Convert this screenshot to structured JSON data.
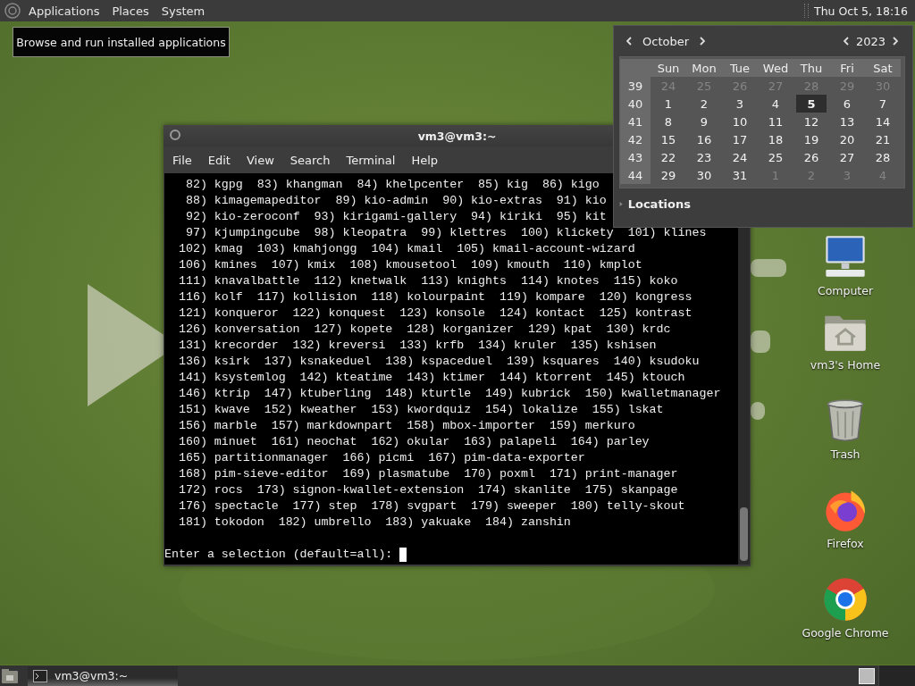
{
  "top_panel": {
    "menus": [
      {
        "label": "Applications"
      },
      {
        "label": "Places"
      },
      {
        "label": "System"
      }
    ],
    "clock": "Thu Oct 5, 18:16"
  },
  "tooltip": "Browse and run installed applications",
  "terminal": {
    "title": "vm3@vm3:~",
    "menu": [
      "File",
      "Edit",
      "View",
      "Search",
      "Terminal",
      "Help"
    ],
    "lines": [
      "82) kgpg  83) khangman  84) khelpcenter  85) kig  86) kigo",
      "88) kimagemapeditor  89) kio-admin  90) kio-extras  91) kio",
      "92) kio-zeroconf  93) kirigami-gallery  94) kiriki  95) kit",
      "97) kjumpingcube  98) kleopatra  99) klettres  100) klickety  101) klines",
      "102) kmag  103) kmahjongg  104) kmail  105) kmail-account-wizard",
      "106) kmines  107) kmix  108) kmousetool  109) kmouth  110) kmplot",
      "111) knavalbattle  112) knetwalk  113) knights  114) knotes  115) koko",
      "116) kolf  117) kollision  118) kolourpaint  119) kompare  120) kongress",
      "121) konqueror  122) konquest  123) konsole  124) kontact  125) kontrast",
      "126) konversation  127) kopete  128) korganizer  129) kpat  130) krdc",
      "131) krecorder  132) kreversi  133) krfb  134) kruler  135) kshisen",
      "136) ksirk  137) ksnakeduel  138) kspaceduel  139) ksquares  140) ksudoku",
      "141) ksystemlog  142) kteatime  143) ktimer  144) ktorrent  145) ktouch",
      "146) ktrip  147) ktuberling  148) kturtle  149) kubrick  150) kwalletmanager",
      "151) kwave  152) kweather  153) kwordquiz  154) lokalize  155) lskat",
      "156) marble  157) markdownpart  158) mbox-importer  159) merkuro",
      "160) minuet  161) neochat  162) okular  163) palapeli  164) parley",
      "165) partitionmanager  166) picmi  167) pim-data-exporter",
      "168) pim-sieve-editor  169) plasmatube  170) poxml  171) print-manager",
      "172) rocs  173) signon-kwallet-extension  174) skanlite  175) skanpage",
      "176) spectacle  177) step  178) svgpart  179) sweeper  180) telly-skout",
      "181) tokodon  182) umbrello  183) yakuake  184) zanshin"
    ],
    "prompt": "Enter a selection (default=all):"
  },
  "calendar": {
    "month": "October",
    "year": "2023",
    "weekdays": [
      "Sun",
      "Mon",
      "Tue",
      "Wed",
      "Thu",
      "Fri",
      "Sat"
    ],
    "weeks": [
      {
        "number": "39",
        "days": [
          {
            "day": "24",
            "other_month": true,
            "selected": false
          },
          {
            "day": "25",
            "other_month": true,
            "selected": false
          },
          {
            "day": "26",
            "other_month": true,
            "selected": false
          },
          {
            "day": "27",
            "other_month": true,
            "selected": false
          },
          {
            "day": "28",
            "other_month": true,
            "selected": false
          },
          {
            "day": "29",
            "other_month": true,
            "selected": false
          },
          {
            "day": "30",
            "other_month": true,
            "selected": false
          }
        ]
      },
      {
        "number": "40",
        "days": [
          {
            "day": "1",
            "other_month": false,
            "selected": false
          },
          {
            "day": "2",
            "other_month": false,
            "selected": false
          },
          {
            "day": "3",
            "other_month": false,
            "selected": false
          },
          {
            "day": "4",
            "other_month": false,
            "selected": false
          },
          {
            "day": "5",
            "other_month": false,
            "selected": true
          },
          {
            "day": "6",
            "other_month": false,
            "selected": false
          },
          {
            "day": "7",
            "other_month": false,
            "selected": false
          }
        ]
      },
      {
        "number": "41",
        "days": [
          {
            "day": "8",
            "other_month": false,
            "selected": false
          },
          {
            "day": "9",
            "other_month": false,
            "selected": false
          },
          {
            "day": "10",
            "other_month": false,
            "selected": false
          },
          {
            "day": "11",
            "other_month": false,
            "selected": false
          },
          {
            "day": "12",
            "other_month": false,
            "selected": false
          },
          {
            "day": "13",
            "other_month": false,
            "selected": false
          },
          {
            "day": "14",
            "other_month": false,
            "selected": false
          }
        ]
      },
      {
        "number": "42",
        "days": [
          {
            "day": "15",
            "other_month": false,
            "selected": false
          },
          {
            "day": "16",
            "other_month": false,
            "selected": false
          },
          {
            "day": "17",
            "other_month": false,
            "selected": false
          },
          {
            "day": "18",
            "other_month": false,
            "selected": false
          },
          {
            "day": "19",
            "other_month": false,
            "selected": false
          },
          {
            "day": "20",
            "other_month": false,
            "selected": false
          },
          {
            "day": "21",
            "other_month": false,
            "selected": false
          }
        ]
      },
      {
        "number": "43",
        "days": [
          {
            "day": "22",
            "other_month": false,
            "selected": false
          },
          {
            "day": "23",
            "other_month": false,
            "selected": false
          },
          {
            "day": "24",
            "other_month": false,
            "selected": false
          },
          {
            "day": "25",
            "other_month": false,
            "selected": false
          },
          {
            "day": "26",
            "other_month": false,
            "selected": false
          },
          {
            "day": "27",
            "other_month": false,
            "selected": false
          },
          {
            "day": "28",
            "other_month": false,
            "selected": false
          }
        ]
      },
      {
        "number": "44",
        "days": [
          {
            "day": "29",
            "other_month": false,
            "selected": false
          },
          {
            "day": "30",
            "other_month": false,
            "selected": false
          },
          {
            "day": "31",
            "other_month": false,
            "selected": false
          },
          {
            "day": "1",
            "other_month": true,
            "selected": false
          },
          {
            "day": "2",
            "other_month": true,
            "selected": false
          },
          {
            "day": "3",
            "other_month": true,
            "selected": false
          },
          {
            "day": "4",
            "other_month": true,
            "selected": false
          }
        ]
      }
    ],
    "locations": {
      "label": "Locations",
      "expanded": false
    }
  },
  "desktop_icons": [
    {
      "label": "Computer",
      "kind": "computer"
    },
    {
      "label": "vm3's Home",
      "kind": "home"
    },
    {
      "label": "Trash",
      "kind": "trash"
    },
    {
      "label": "Firefox",
      "kind": "firefox"
    },
    {
      "label": "Google Chrome",
      "kind": "chrome"
    }
  ],
  "taskbar": {
    "tasks": [
      {
        "label": "vm3@vm3:~",
        "selected": true
      }
    ]
  }
}
